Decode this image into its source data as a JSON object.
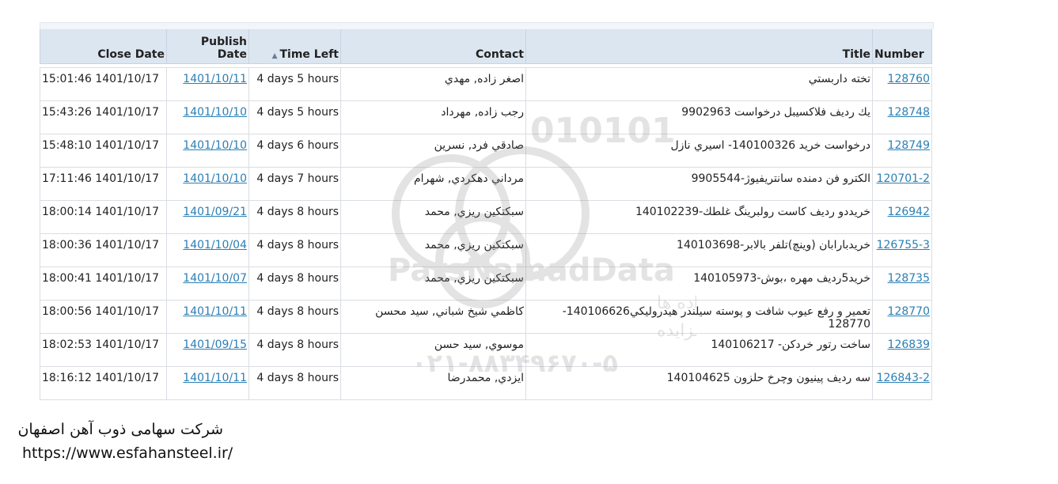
{
  "table": {
    "headers": {
      "close_date": "Close Date",
      "publish_line1": "Publish",
      "publish_line2": "Date",
      "time_left": "Time Left",
      "contact": "Contact",
      "title": "Title",
      "number": "Number"
    },
    "sort_icon": "sort-ascending-icon",
    "rows": [
      {
        "close": "15:01:46 1401/10/17",
        "publish": "1401/10/11",
        "time_left": "4 days 5 hours",
        "contact": "اصغر زاده, مهدي",
        "title": "تخته داربستي",
        "number": "128760"
      },
      {
        "close": "15:43:26 1401/10/17",
        "publish": "1401/10/10",
        "time_left": "4 days 5 hours",
        "contact": "رجب زاده, مهرداد",
        "title": "يك رديف فلاكسيبل درخواست 9902963",
        "number": "128748"
      },
      {
        "close": "15:48:10 1401/10/17",
        "publish": "1401/10/10",
        "time_left": "4 days 6 hours",
        "contact": "صادقي فرد, نسرين",
        "title": "درخواست خريد 140100326- اسيري نازل",
        "number": "128749"
      },
      {
        "close": "17:11:46 1401/10/17",
        "publish": "1401/10/10",
        "time_left": "4 days 7 hours",
        "contact": "مرداني دهكردي, شهرام",
        "title": "الكترو فن دمنده سانتريفيوژ-9905544",
        "number": "120701-2"
      },
      {
        "close": "18:00:14 1401/10/17",
        "publish": "1401/09/21",
        "time_left": "4 days 8 hours",
        "contact": "سبكتكين ريزي, محمد",
        "title": "خريددو رديف كاست رولبرينگ غلطك-140102239",
        "number": "126942"
      },
      {
        "close": "18:00:36 1401/10/17",
        "publish": "1401/10/04",
        "time_left": "4 days 8 hours",
        "contact": "سبكتكين ريزي, محمد",
        "title": "خريدبارابان (وينچ)تلفر بالابر-140103698",
        "number": "126755-3"
      },
      {
        "close": "18:00:41 1401/10/17",
        "publish": "1401/10/07",
        "time_left": "4 days 8 hours",
        "contact": "سبكتكين ريزي, محمد",
        "title": "خريد5رديف مهره ،بوش-140105973",
        "number": "128735"
      },
      {
        "close": "18:00:56 1401/10/17",
        "publish": "1401/10/11",
        "time_left": "4 days 8 hours",
        "contact": "كاظمي شيخ شباني, سيد محسن",
        "title": "تعمير و رفع عيوب شافت و پوسته سيلندر هيدروليكي140106626-128770",
        "number": "128770"
      },
      {
        "close": "18:02:53 1401/10/17",
        "publish": "1401/09/15",
        "time_left": "4 days 8 hours",
        "contact": "موسوي, سيد حسن",
        "title": "ساخت رتور خردكن- 140106217",
        "number": "126839"
      },
      {
        "close": "18:16:12 1401/10/17",
        "publish": "1401/10/11",
        "time_left": "4 days 8 hours",
        "contact": "ايزدي, محمدرضا",
        "title": "سه رديف پينيون وچرخ حلزون 140104625",
        "number": "126843-2"
      }
    ]
  },
  "watermark": {
    "line1": "ParsNamadData",
    "line2": "مرکز فرآوری اطلاعات پارس نماد داده ها",
    "line3": "پایگاه اطلاع رسانی مناقصه ومزایده",
    "line4": "۰۲۱-۸۸۳۴۹۶۷۰-۵",
    "digits": "010101"
  },
  "footer": {
    "company": "شرکت سهامی ذوب آهن اصفهان",
    "url": "https://www.esfahansteel.ir/"
  }
}
